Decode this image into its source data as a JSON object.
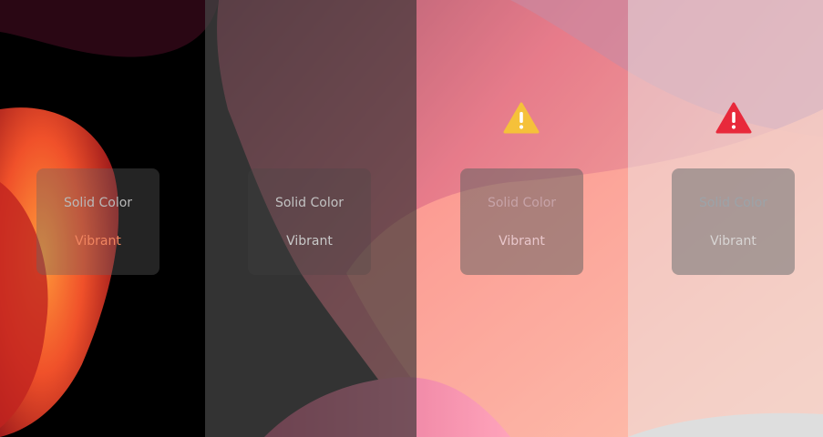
{
  "colors": {
    "warning_yellow": "#F5C13A",
    "warning_red": "#E8293B",
    "vibrant_accent": "#F08560"
  },
  "icons": {
    "warning_yellow": "exclamation-triangle",
    "warning_red": "exclamation-triangle"
  },
  "columns": [
    {
      "appearance": "dark",
      "solid_label": "Solid Color",
      "vibrant_label": "Vibrant"
    },
    {
      "appearance": "dark-gray",
      "solid_label": "Solid Color",
      "vibrant_label": "Vibrant"
    },
    {
      "appearance": "light",
      "solid_label": "Solid Color",
      "vibrant_label": "Vibrant"
    },
    {
      "appearance": "extra-light",
      "solid_label": "Solid Color",
      "vibrant_label": "Vibrant"
    }
  ]
}
